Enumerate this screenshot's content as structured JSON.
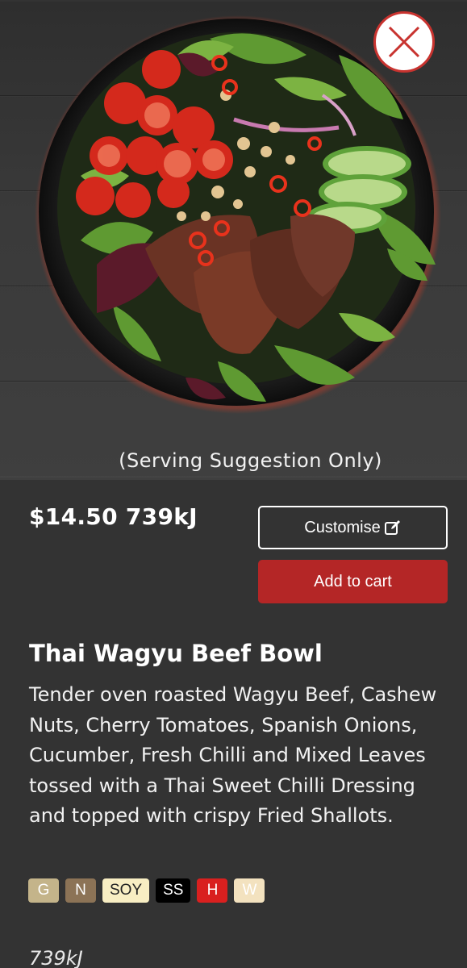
{
  "hero": {
    "image_alt": "Thai Wagyu Beef Bowl salad",
    "caption": "(Serving Suggestion Only)"
  },
  "close_icon": "close-icon",
  "product": {
    "price_line": "$14.50 739kJ",
    "customise_label": "Customise",
    "customise_icon": "edit-icon",
    "add_to_cart_label": "Add to cart",
    "title": "Thai Wagyu Beef Bowl",
    "description": "Tender oven roasted Wagyu Beef, Cashew Nuts, Cherry Tomatoes, Spanish Onions, Cucumber, Fresh Chilli and Mixed Leaves tossed with a Thai Sweet Chilli Dressing and topped with crispy Fried Shallots.",
    "energy_footer": "739kJ"
  },
  "dietary_badges": [
    {
      "label": "G",
      "bg": "#c4b48a",
      "fg": "#ffffff"
    },
    {
      "label": "N",
      "bg": "#8c7356",
      "fg": "#ffffff"
    },
    {
      "label": "SOY",
      "bg": "#f8eec3",
      "fg": "#222222"
    },
    {
      "label": "SS",
      "bg": "#000000",
      "fg": "#ffffff"
    },
    {
      "label": "H",
      "bg": "#d9201f",
      "fg": "#ffffff"
    },
    {
      "label": "W",
      "bg": "#f3e2bf",
      "fg": "#ffffff"
    }
  ],
  "colors": {
    "background": "#333333",
    "accent_red": "#b42626",
    "close_ring": "#c8332f"
  }
}
